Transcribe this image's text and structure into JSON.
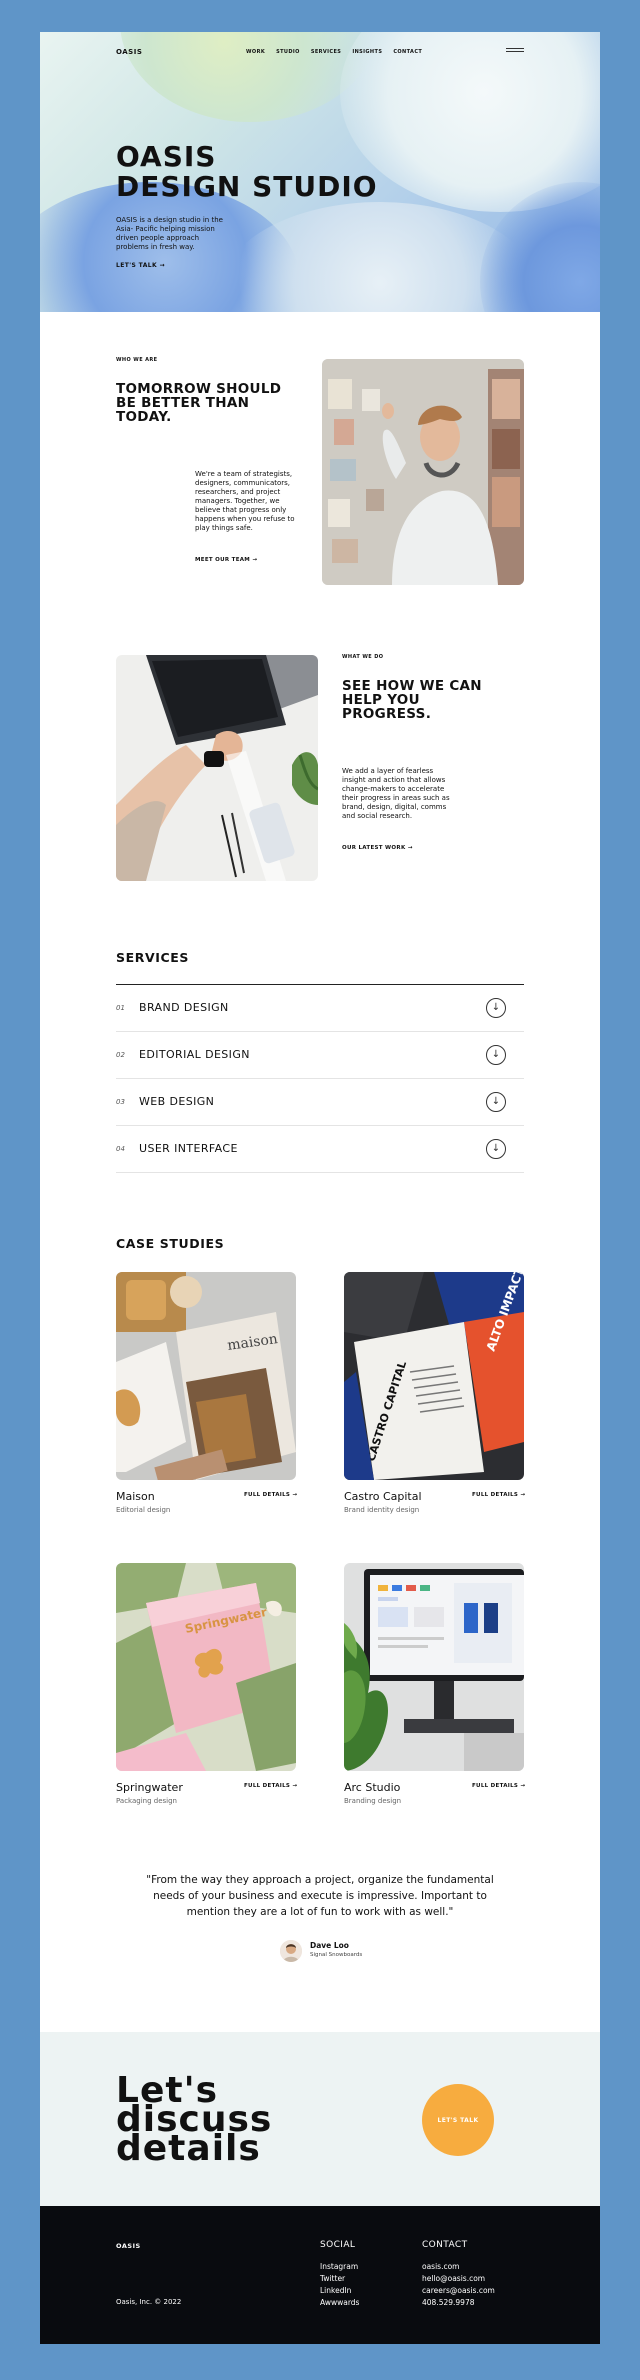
{
  "nav": {
    "logo": "OASIS",
    "items": [
      "WORK",
      "STUDIO",
      "SERVICES",
      "INSIGHTS",
      "CONTACT"
    ]
  },
  "hero": {
    "title_line1": "OASIS",
    "title_line2": "DESIGN STUDIO",
    "description": "OASIS is a design studio in the Asia- Pacific helping mission driven people approach problems in fresh way.",
    "cta": "LET'S TALK"
  },
  "who": {
    "eyebrow": "WHO WE ARE",
    "heading_l1": "TOMORROW SHOULD",
    "heading_l2": "BE BETTER THAN",
    "heading_l3": "TODAY.",
    "body": "We're a team of strategists, designers, communicators, researchers, and project managers. Together, we believe that progress only happens when you refuse to play things safe.",
    "link": "MEET OUR TEAM"
  },
  "what": {
    "eyebrow": "WHAT WE DO",
    "heading_l1": "SEE HOW WE CAN",
    "heading_l2": "HELP YOU",
    "heading_l3": "PROGRESS.",
    "body": "We add a layer of fearless insight and action that allows change-makers to accelerate their progress in areas such as brand, design, digital, comms and social research.",
    "link": "OUR LATEST WORK"
  },
  "services": {
    "title": "SERVICES",
    "items": [
      {
        "num": "01",
        "name": "BRAND DESIGN"
      },
      {
        "num": "02",
        "name": "EDITORIAL DESIGN"
      },
      {
        "num": "03",
        "name": "WEB DESIGN"
      },
      {
        "num": "04",
        "name": "USER INTERFACE"
      }
    ]
  },
  "case_studies": {
    "title": "CASE STUDIES",
    "link_label": "FULL DETAILS",
    "items": [
      {
        "name": "Maison",
        "type": "Editorial design",
        "cover_text": "maison"
      },
      {
        "name": "Castro Capital",
        "type": "Brand identity design",
        "cover_text": "CASTRO CAPITAL",
        "cover_text2": "ALTO IMPACTO EN FUTURO"
      },
      {
        "name": "Springwater",
        "type": "Packaging design",
        "cover_text": "Springwater"
      },
      {
        "name": "Arc Studio",
        "type": "Branding design"
      }
    ]
  },
  "testimonial": {
    "quote": "\"From the way they approach a project, organize the fundamental needs of your business and execute is impressive. Important to mention they are a lot of fun to work with as well.\"",
    "author": "Dave Loo",
    "company": "Signal Snowboards"
  },
  "discuss": {
    "line1": "Let's",
    "line2": "discuss",
    "line3": "details",
    "button": "LET'S TALK"
  },
  "footer": {
    "logo": "OASIS",
    "copyright": "Oasis, Inc. © 2022",
    "social_heading": "SOCIAL",
    "social": [
      "Instagram",
      "Twitter",
      "LinkedIn",
      "Awwwards"
    ],
    "contact_heading": "CONTACT",
    "contact": [
      "oasis.com",
      "hello@oasis.com",
      "careers@oasis.com",
      "408.529.9978"
    ]
  },
  "colors": {
    "frame": "#5f95c8",
    "accent": "#f7ac3f",
    "footer": "#090b0f",
    "discuss_bg": "#edf3f3"
  }
}
